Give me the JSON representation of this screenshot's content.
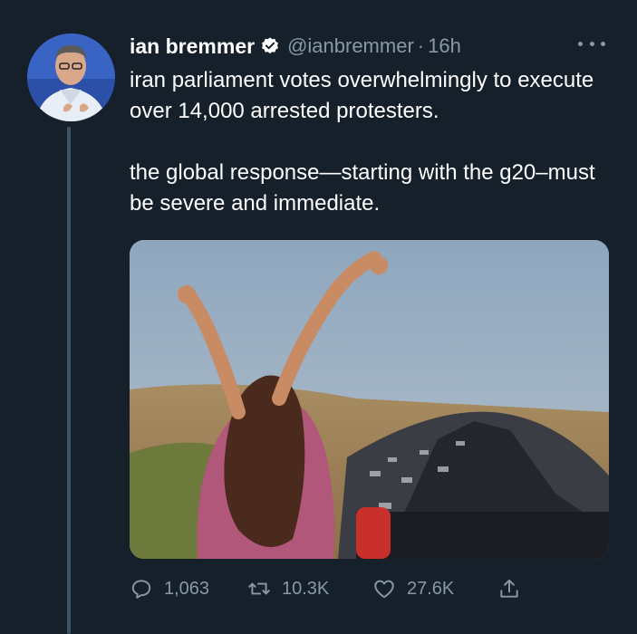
{
  "author": {
    "name": "ian bremmer",
    "handle": "@ianbremmer",
    "separator": "·",
    "time": "16h",
    "verified": true
  },
  "tweet": {
    "paragraph1": "iran parliament votes overwhelmingly to execute over 14,000 arrested protesters.",
    "paragraph2": "the global response—starting with the g20–must be severe and immediate."
  },
  "actions": {
    "replies": "1,063",
    "retweets": "10.3K",
    "likes": "27.6K"
  },
  "icons": {
    "verified": "verified-badge-icon",
    "more": "more-options-icon",
    "reply": "reply-icon",
    "retweet": "retweet-icon",
    "like": "heart-icon",
    "share": "share-icon"
  },
  "colors": {
    "background": "#15202b",
    "secondary_text": "#8899a6",
    "primary_text": "#ffffff"
  }
}
